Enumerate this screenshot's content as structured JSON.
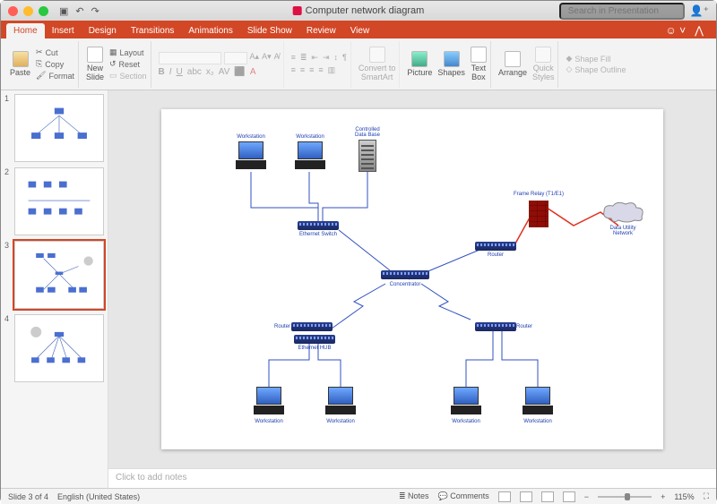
{
  "window": {
    "title": "Computer network diagram",
    "search_placeholder": "Search in Presentation"
  },
  "tabs": {
    "items": [
      "Home",
      "Insert",
      "Design",
      "Transitions",
      "Animations",
      "Slide Show",
      "Review",
      "View"
    ],
    "active": 0
  },
  "ribbon": {
    "paste": "Paste",
    "cut": "Cut",
    "copy": "Copy",
    "format": "Format",
    "new_slide": "New\nSlide",
    "layout": "Layout",
    "reset": "Reset",
    "section": "Section",
    "convert": "Convert to\nSmartArt",
    "picture": "Picture",
    "shapes": "Shapes",
    "textbox": "Text\nBox",
    "arrange": "Arrange",
    "quick_styles": "Quick\nStyles",
    "shape_fill": "Shape Fill",
    "shape_outline": "Shape Outline"
  },
  "thumbs": {
    "count": 4,
    "selected": 3
  },
  "notes_placeholder": "Click to add notes",
  "status": {
    "slide": "Slide 3 of 4",
    "lang": "English (United States)",
    "notes": "Notes",
    "comments": "Comments",
    "zoom": "115%"
  },
  "diagram": {
    "workstation": "Workstation",
    "controlled_db": "Controlled\nData Base",
    "eth_switch": "Ethernet Switch",
    "concentrator": "Concentrator",
    "router": "Router",
    "eth_hub": "Ethernet HUB",
    "frame_relay": "Frame Relay (T1/E1)",
    "data_utility": "Data Utility\nNetwork"
  }
}
